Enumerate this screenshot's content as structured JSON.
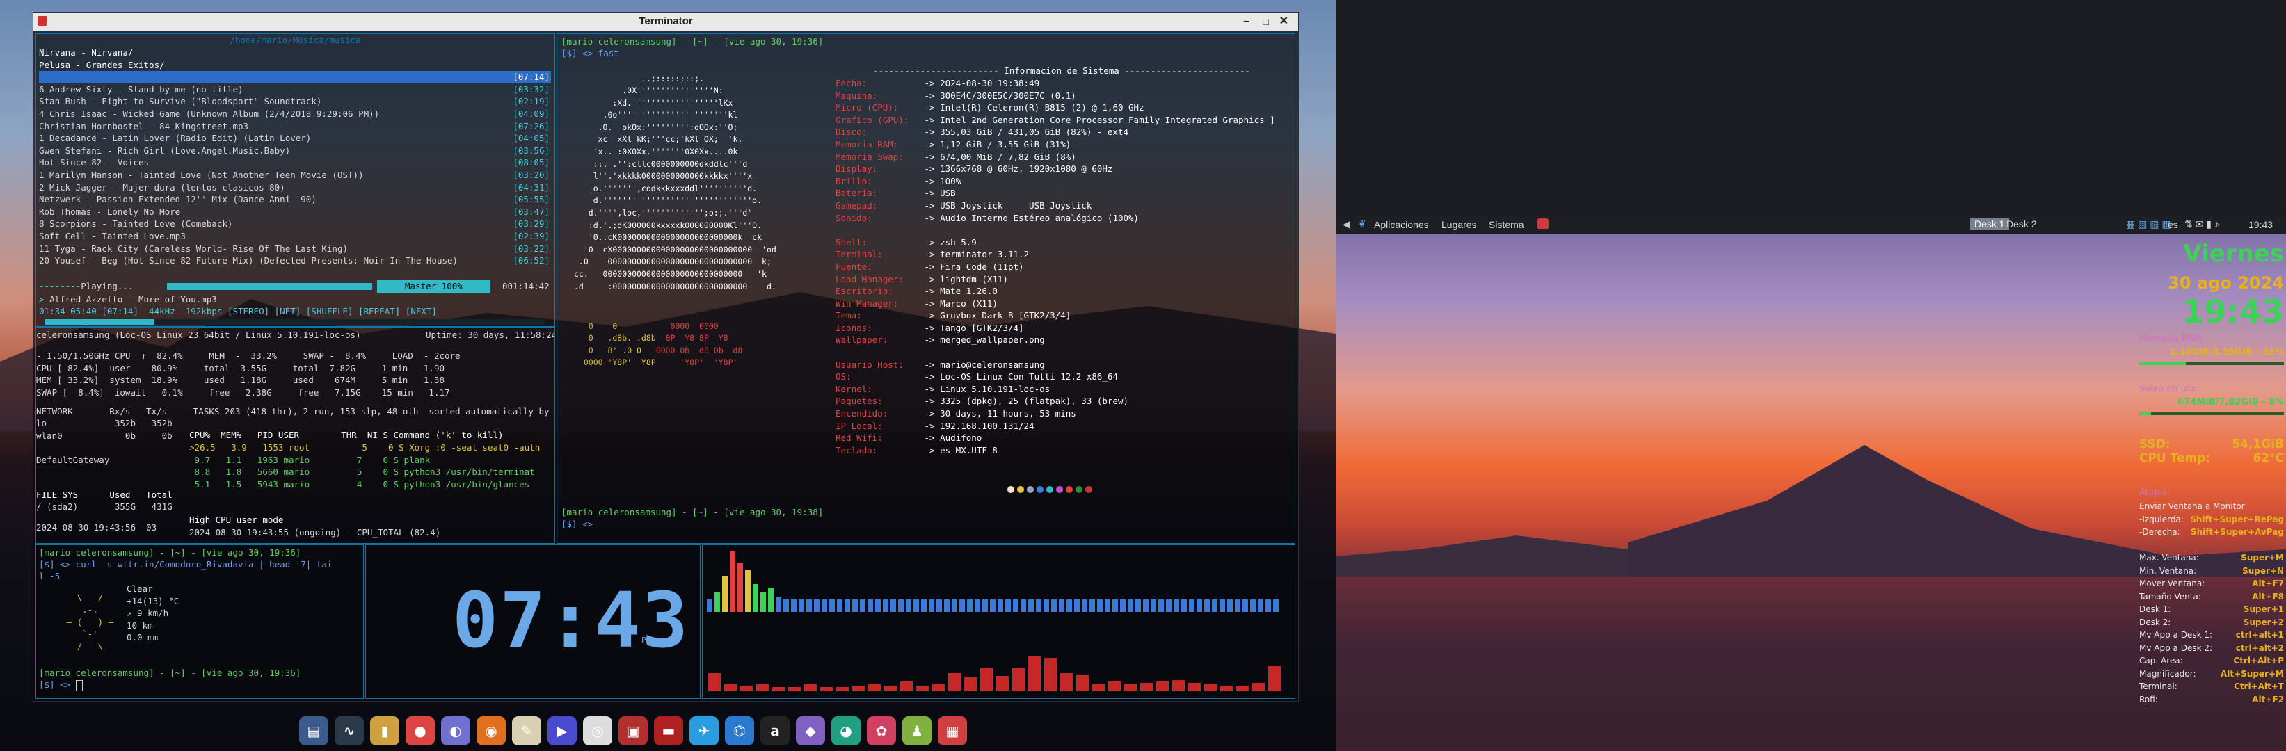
{
  "window": {
    "title": "Terminator"
  },
  "music": {
    "path_title": "/home/mario/Música/musica",
    "lines": [
      {
        "text": "Nirvana - Nirvana/",
        "time": ""
      },
      {
        "text": "Pelusa - Grandes Exitos/",
        "time": ""
      },
      {
        "text": "",
        "time": "[07:14]"
      },
      {
        "text": "6 Andrew Sixty - Stand by me (no title)",
        "time": "[03:32]"
      },
      {
        "text": "Stan Bush - Fight to Survive (\"Bloodsport\" Soundtrack)",
        "time": "[02:19]"
      },
      {
        "text": "4 Chris Isaac - Wicked Game (Unknown Album (2/4/2018 9:29:06 PM))",
        "time": "[04:09]"
      },
      {
        "text": "Christian Hornbostel - 84 Kingstreet.mp3",
        "time": "[07:26]"
      },
      {
        "text": "1 Decadance - Latin Lover (Radio Edit) (Latin Lover)",
        "time": "[04:05]"
      },
      {
        "text": "Gwen Stefani - Rich Girl (Love.Angel.Music.Baby)",
        "time": "[03:56]"
      },
      {
        "text": "Hot Since 82 - Voices",
        "time": "[08:05]"
      },
      {
        "text": "1 Marilyn Manson - Tainted Love (Not Another Teen Movie (OST))",
        "time": "[03:20]"
      },
      {
        "text": "2 Mick Jagger - Mujer dura (lentos clasicos 80)",
        "time": "[04:31]"
      },
      {
        "text": "Netzwerk - Passion Extended 12'' Mix (Dance Anni '90)",
        "time": "[05:55]"
      },
      {
        "text": "Rob Thomas - Lonely No More",
        "time": "[03:47]"
      },
      {
        "text": "8 Scorpions - Tainted Love (Comeback)",
        "time": "[03:29]"
      },
      {
        "text": "Soft Cell - Tainted Love.mp3",
        "time": "[02:39]"
      },
      {
        "text": "11 Tyga - Rack City (Careless World- Rise Of The Last King)",
        "time": "[03:22]"
      },
      {
        "text": "20 Yousef - Beg (Hot Since 82 Future Mix) (Defected Presents: Noir In The House)",
        "time": "[06:52]"
      }
    ],
    "playing_label": "Playing...",
    "master": "Master 100%",
    "elapsed_total": "001:14:42",
    "now_playing": "Alfred Azzetto - More of You.mp3",
    "status_line": "01:34 05:40 [07:14]  44kHz  192kbps [STEREO] [NET] [SHUFFLE] [REPEAT] [NEXT]",
    "progress": 0.22
  },
  "glances": {
    "host_line": "celeronsamsung (Loc-OS Linux 23 64bit / Linux 5.10.191-loc-os)",
    "uptime": "Uptime: 30 days, 11:58:24",
    "cpu_rows": [
      "- 1.50/1.50GHz CPU  ↑  82.4%     MEM  -  33.2%     SWAP -  8.4%     LOAD  - 2core",
      "CPU [ 82.4%]  user    80.9%     total  3.55G     total  7.82G     1 min   1.90",
      "MEM [ 33.2%]  system  18.9%     used   1.18G     used    674M     5 min   1.38",
      "SWAP [  8.4%]  iowait   0.1%     free   2.38G     free   7.15G    15 min   1.17"
    ],
    "network_header": "NETWORK       Rx/s   Tx/s     TASKS 203 (418 thr), 2 run, 153 slp, 48 oth  sorted automatically by CPU consumption",
    "net_rows": [
      "lo             352b   352b",
      "wlan0            0b     0b",
      "",
      "DefaultGateway"
    ],
    "proc_header": "CPU%  MEM%   PID USER        THR  NI S Command ('k' to kill)",
    "proc_rows": [
      ">26.5   3.9   1553 root          5    0 S Xorg :0 -seat seat0 -auth",
      " 9.7   1.1   1963 mario         7    0 S plank",
      " 8.8   1.8   5660 mario         5    0 S python3 /usr/bin/terminat",
      " 5.1   1.5   5943 mario         4    0 S python3 /usr/bin/glances"
    ],
    "fs_header": "FILE SYS      Used   Total",
    "fs_row": "/ (sda2)       355G   431G",
    "alert_time": "2024-08-30 19:43:56 -03",
    "alert_title": "High CPU user mode",
    "alert_line": "2024-08-30 19:43:55 (ongoing) - CPU_TOTAL (82.4)"
  },
  "neofetch": {
    "prompt_user": "[mario celeronsamsung] - [~] - [vie ago 30, 19:36]",
    "prompt_cmd": "[$] <> fast",
    "header": "Informacion de Sistema",
    "info": [
      [
        "Fecha:",
        "2024-08-30 19:38:49"
      ],
      [
        "Maquina:",
        "300E4C/300E5C/300E7C (0.1)"
      ],
      [
        "Micro (CPU):",
        "Intel(R) Celeron(R) B815 (2) @ 1,60 GHz"
      ],
      [
        "Grafico (GPU):",
        "Intel 2nd Generation Core Processor Family Integrated Graphics ]"
      ],
      [
        "Disco:",
        "355,03 GiB / 431,05 GiB (82%) - ext4"
      ],
      [
        "Memoria RAM:",
        "1,12 GiB / 3,55 GiB (31%)"
      ],
      [
        "Memoria Swap:",
        "674,00 MiB / 7,82 GiB (8%)"
      ],
      [
        "Display:",
        "1366x768 @ 60Hz, 1920x1080 @ 60Hz"
      ],
      [
        "Brillo:",
        "100%"
      ],
      [
        "Bateria:",
        "USB"
      ],
      [
        "Gamepad:",
        "USB Joystick     USB Joystick"
      ],
      [
        "Sonido:",
        "Audio Interno Estéreo analógico (100%)"
      ],
      [
        "",
        ""
      ],
      [
        "Shell:",
        "zsh 5.9"
      ],
      [
        "Terminal:",
        "terminator 3.11.2"
      ],
      [
        "Fuente:",
        "Fira Code (11pt)"
      ],
      [
        "Load Manager:",
        "lightdm (X11)"
      ],
      [
        "Escritorio:",
        "Mate 1.26.0"
      ],
      [
        "Win Manager:",
        "Marco (X11)"
      ],
      [
        "Tema:",
        "Gruvbox-Dark-B [GTK2/3/4]"
      ],
      [
        "Iconos:",
        "Tango [GTK2/3/4]"
      ],
      [
        "Wallpaper:",
        "merged_wallpaper.png"
      ],
      [
        "",
        ""
      ],
      [
        "Usuario Host:",
        "mario@celeronsamsung"
      ],
      [
        "OS:",
        "Loc-OS Linux Con Tutti 12.2 x86_64"
      ],
      [
        "Kernel:",
        "Linux 5.10.191-loc-os"
      ],
      [
        "Paquetes:",
        "3325 (dpkg), 25 (flatpak), 33 (brew)"
      ],
      [
        "Encendido:",
        "30 days, 11 hours, 53 mins"
      ],
      [
        "IP Local:",
        "192.168.100.131/24"
      ],
      [
        "Red Wifi:",
        "Audifono"
      ],
      [
        "Teclado:",
        "es_MX.UTF-8"
      ]
    ],
    "prompt2_user": "[mario celeronsamsung] - [~] - [vie ago 30, 19:38]",
    "prompt2_cmd": "[$] <>",
    "palette": [
      "#f5e6c8",
      "#e0c43a",
      "#9aa5b8",
      "#3f7be0",
      "#33b8c8",
      "#c050c8",
      "#e04040",
      "#2e8a3e",
      "#c23a3a"
    ]
  },
  "weather": {
    "prompt": "[mario celeronsamsung] - [~] - [vie ago 30, 19:36]",
    "cmd": "[$] <> curl -s wttr.in/Comodoro_Rivadavia | head -7| tai",
    "cont": "l -5",
    "lines": [
      [
        "Clear",
        ""
      ],
      [
        "+14(13) °C",
        ""
      ],
      [
        "↗ 9 km/h",
        ""
      ],
      [
        "10 km",
        ""
      ],
      [
        "0.0 mm",
        ""
      ]
    ],
    "prompt2": "[mario celeronsamsung] - [~] - [vie ago 30, 19:36]",
    "prompt2_cmd": "[$] <>"
  },
  "clock": {
    "time": "07:43",
    "ampm": "PM"
  },
  "right_panel": {
    "menu": [
      "Aplicaciones",
      "Lugares",
      "Sistema"
    ],
    "desks": [
      "Desk 1",
      "Desk 2"
    ],
    "lang": "es",
    "time": "19:43"
  },
  "conky": {
    "day": "Viernes",
    "date": "30 ago 2024",
    "time": "19:43",
    "ram_label": "Memoria RAM",
    "ram_value": "1,14GiB/3,55GiB - 32%",
    "ram_fraction": 0.32,
    "swap_label": "Swap en uso:",
    "swap_value": "674MiB/7,82GiB - 8%",
    "swap_fraction": 0.08,
    "ssd_label": "SSD:",
    "ssd_value": "54,1GiB",
    "cpu_temp_label": "CPU Temp:",
    "cpu_temp_value": "62°C",
    "shortcuts_title": "Atajos:",
    "shortcuts": [
      [
        "Enviar Ventana a Monitor",
        ""
      ],
      [
        "-Izquierda:",
        "Shift+Super+RePag"
      ],
      [
        "-Derecha:",
        "Shift+Super+AvPag"
      ],
      [
        "",
        ""
      ],
      [
        "Max. Ventana:",
        "Super+M"
      ],
      [
        "Min. Ventana:",
        "Super+N"
      ],
      [
        "Mover Ventana:",
        "Alt+F7"
      ],
      [
        "Tamaño Venta:",
        "Alt+F8"
      ],
      [
        "Desk 1:",
        "Super+1"
      ],
      [
        "Desk 2:",
        "Super+2"
      ],
      [
        "Mv App a Desk 1:",
        "ctrl+alt+1"
      ],
      [
        "Mv App a Desk 2:",
        "ctrl+alt+2"
      ],
      [
        "Cap. Area:",
        "Ctrl+Alt+P"
      ],
      [
        "Magnificador:",
        "Alt+Super+M"
      ],
      [
        "Terminal:",
        "Ctrl+Alt+T"
      ],
      [
        "Rofi:",
        "Alt+F2"
      ]
    ]
  },
  "taskbar": {
    "apps": [
      [
        "system-monitor-icon",
        "#3b5b8c",
        "▤"
      ],
      [
        "activity-icon",
        "#2a3a4a",
        "∿"
      ],
      [
        "files-icon",
        "#d0a040",
        "▮"
      ],
      [
        "chrome-icon",
        "#d44",
        "●"
      ],
      [
        "browser-icon",
        "#7070d0",
        "◐"
      ],
      [
        "firefox-icon",
        "#e07020",
        "◉"
      ],
      [
        "editor-icon",
        "#d8d0b0",
        "✎"
      ],
      [
        "media-icon",
        "#4a4ad0",
        "▶"
      ],
      [
        "camera-icon",
        "#ddd",
        "◎"
      ],
      [
        "archive-icon",
        "#b03030",
        "▣"
      ],
      [
        "terminal-icon",
        "#b02020",
        "▬"
      ],
      [
        "telegram-icon",
        "#2a9de0",
        "✈"
      ],
      [
        "vscode-icon",
        "#2a7ad0",
        "⌬"
      ],
      [
        "amazon-icon",
        "#222",
        "a"
      ],
      [
        "tor-icon",
        "#8060c0",
        "◆"
      ],
      [
        "chat-icon",
        "#20a080",
        "◕"
      ],
      [
        "settings-icon",
        "#d04060",
        "✿"
      ],
      [
        "bottle-icon",
        "#80b040",
        "♟"
      ],
      [
        "notes-icon",
        "#d04040",
        "▦"
      ]
    ]
  },
  "cava": {
    "top": [
      18,
      28,
      52,
      88,
      70,
      60,
      40,
      28,
      34,
      22,
      18,
      18,
      18,
      18,
      18,
      18,
      18,
      18,
      18,
      18,
      18,
      18,
      18,
      18,
      18,
      18,
      18,
      18,
      18,
      18,
      18,
      18,
      18,
      18,
      18,
      18,
      18,
      18,
      18,
      18,
      18,
      18,
      18,
      18,
      18,
      18,
      18,
      18,
      18,
      18,
      18,
      18,
      18,
      18,
      18,
      18,
      18,
      18,
      18,
      18,
      18,
      18,
      18,
      18,
      18,
      18,
      18,
      18,
      18,
      18,
      18,
      18,
      18,
      18,
      18
    ],
    "bottom": [
      26,
      10,
      8,
      10,
      6,
      6,
      10,
      6,
      6,
      8,
      10,
      8,
      14,
      8,
      10,
      26,
      20,
      34,
      22,
      34,
      50,
      48,
      26,
      24,
      10,
      14,
      10,
      12,
      14,
      16,
      12,
      10,
      8,
      8,
      12,
      36
    ]
  }
}
